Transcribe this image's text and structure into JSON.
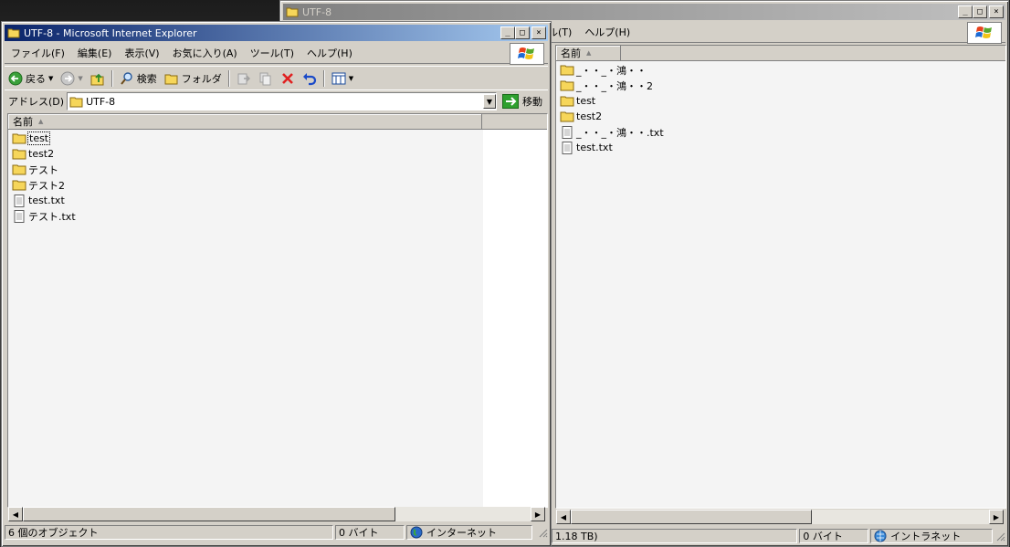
{
  "back_window": {
    "title": "UTF-8",
    "menu_fragment": "ル(T)",
    "menu_help": "ヘルプ(H)",
    "column_name": "名前",
    "items": [
      {
        "name": "_・・_・鴻・・",
        "type": "folder"
      },
      {
        "name": "_・・_・鴻・・2",
        "type": "folder"
      },
      {
        "name": "test",
        "type": "folder"
      },
      {
        "name": "test2",
        "type": "folder"
      },
      {
        "name": "_・・_・鴻・・.txt",
        "type": "file"
      },
      {
        "name": "test.txt",
        "type": "file"
      }
    ],
    "status": {
      "objects": "1.18 TB)",
      "size": "0 バイト",
      "zone": "イントラネット"
    }
  },
  "front_window": {
    "title": "UTF-8 - Microsoft Internet Explorer",
    "menu": [
      "ファイル(F)",
      "編集(E)",
      "表示(V)",
      "お気に入り(A)",
      "ツール(T)",
      "ヘルプ(H)"
    ],
    "toolbar": {
      "back": "戻る",
      "search": "検索",
      "folders": "フォルダ"
    },
    "address": {
      "label": "アドレス(D)",
      "value": "UTF-8",
      "go": "移動"
    },
    "column_name": "名前",
    "items": [
      {
        "name": "test",
        "type": "folder"
      },
      {
        "name": "test2",
        "type": "folder"
      },
      {
        "name": "テスト",
        "type": "folder"
      },
      {
        "name": "テスト2",
        "type": "folder"
      },
      {
        "name": "test.txt",
        "type": "file"
      },
      {
        "name": "テスト.txt",
        "type": "file"
      }
    ],
    "status": {
      "objects": "6 個のオブジェクト",
      "size": "0 バイト",
      "zone": "インターネット"
    }
  },
  "colors": {
    "title_active": "#0a246a",
    "title_inactive": "#808080",
    "chrome": "#d4d0c8"
  }
}
